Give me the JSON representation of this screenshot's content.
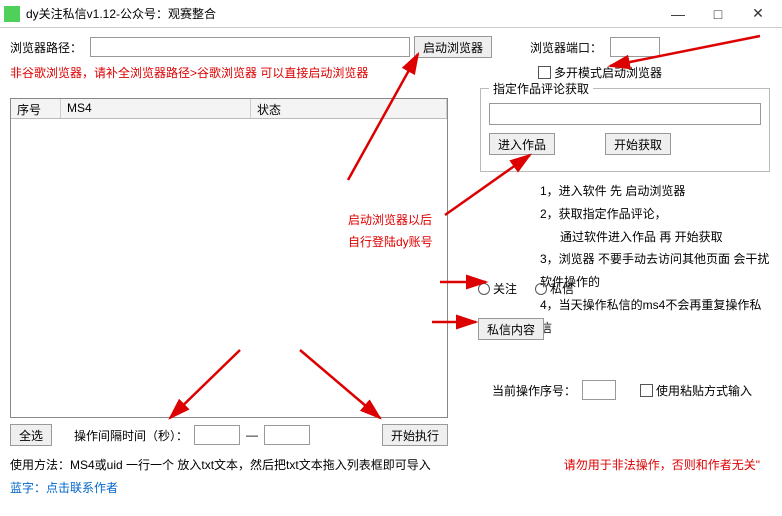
{
  "title": "dy关注私信v1.12-公众号：观赛整合",
  "top": {
    "browser_path_label": "浏览器路径：",
    "browser_path_value": "",
    "launch_browser": "启动浏览器",
    "browser_port_label": "浏览器端口：",
    "browser_port_value": "",
    "note_line": "非谷歌浏览器，请补全浏览器路径>谷歌浏览器 可以直接启动浏览器",
    "multi_open_label": "多开模式启动浏览器"
  },
  "list": {
    "col1": "序号",
    "col2": "MS4",
    "col3": "状态"
  },
  "group": {
    "title": "指定作品评论获取",
    "input_value": "",
    "enter_product": "进入作品",
    "start_fetch": "开始获取"
  },
  "midnotes": {
    "a": "启动浏览器以后",
    "b": "自行登陆dy账号"
  },
  "radios": {
    "follow": "关注",
    "dm": "私信"
  },
  "dm_content_btn": "私信内容",
  "steps": {
    "s1": "1，进入软件 先 启动浏览器",
    "s2": "2，获取指定作品评论，",
    "s2b": "通过软件进入作品 再 开始获取",
    "s3": "3，浏览器 不要手动去访问其他页面 会干扰软件操作的",
    "s4": "4，当天操作私信的ms4不会再重复操作私信"
  },
  "cur": {
    "label": "当前操作序号：",
    "value": "",
    "paste_label": "使用粘贴方式输入"
  },
  "bottom": {
    "select_all": "全选",
    "interval_label": "操作间隔时间（秒）：",
    "interval_from": "",
    "interval_to": "",
    "dash": "—",
    "start_exec": "开始执行"
  },
  "footer": {
    "usage": "使用方法：MS4或uid 一行一个 放入txt文本，然后把txt文本拖入列表框即可导入",
    "warn": "请勿用于非法操作，否则和作者无关\"",
    "contact": "蓝字：点击联系作者"
  }
}
